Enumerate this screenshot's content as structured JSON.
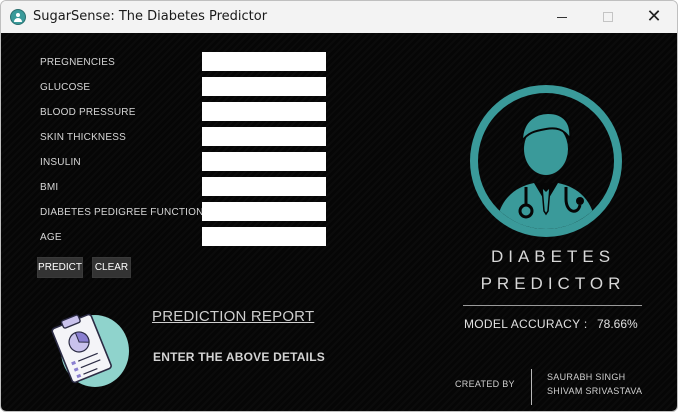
{
  "window": {
    "title": "SugarSense: The Diabetes Predictor",
    "close_glyph": "✕"
  },
  "form": {
    "fields": [
      {
        "label": "PREGNENCIES",
        "value": ""
      },
      {
        "label": "GLUCOSE",
        "value": ""
      },
      {
        "label": "BLOOD PRESSURE",
        "value": ""
      },
      {
        "label": "SKIN THICKNESS",
        "value": ""
      },
      {
        "label": "INSULIN",
        "value": ""
      },
      {
        "label": "BMI",
        "value": ""
      },
      {
        "label": "DIABETES PEDIGREE FUNCTION",
        "value": ""
      },
      {
        "label": "AGE",
        "value": ""
      }
    ],
    "predict_label": "PREDICT",
    "clear_label": "CLEAR"
  },
  "report": {
    "title": "PREDICTION REPORT",
    "result": "ENTER THE ABOVE DETAILS"
  },
  "brand": {
    "line1": "DIABETES",
    "line2": "PREDICTOR",
    "accuracy_label": "MODEL ACCURACY :",
    "accuracy_value": "78.66%"
  },
  "credits": {
    "created_by": "CREATED BY",
    "authors": [
      "SAURABH SINGH",
      "SHIVAM SRIVASTAVA"
    ]
  },
  "colors": {
    "background": "#060606",
    "logo_teal": "#3a9a9a",
    "illustration_teal": "#8fd3cc",
    "button_bg": "#333333"
  },
  "icons": {
    "app": "doctor-icon",
    "logo": "doctor-stethoscope-icon",
    "report": "clipboard-chart-icon"
  }
}
